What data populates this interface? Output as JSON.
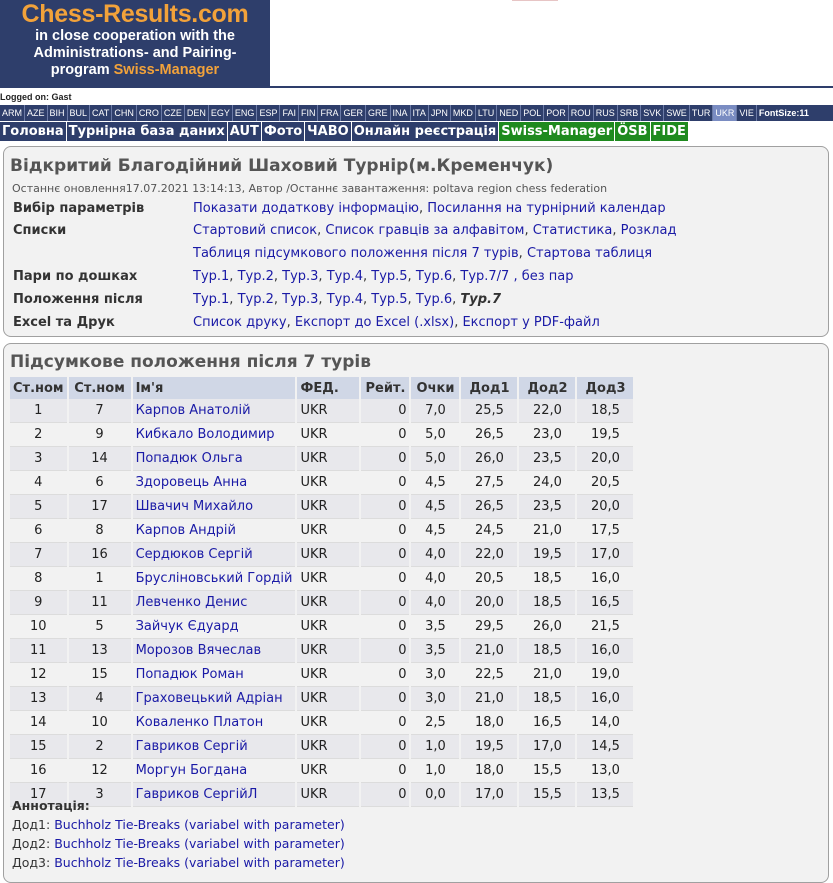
{
  "logo": {
    "title": "Chess-Results.com",
    "line1": "in close cooperation with the",
    "line2": "Administrations- and Pairing-",
    "line3_prefix": "program ",
    "line3_highlight": "Swiss-Manager"
  },
  "logged_on": "Logged on: Gast",
  "languages": [
    "ARM",
    "AZE",
    "BIH",
    "BUL",
    "CAT",
    "CHN",
    "CRO",
    "CZE",
    "DEN",
    "EGY",
    "ENG",
    "ESP",
    "FAI",
    "FIN",
    "FRA",
    "GER",
    "GRE",
    "INA",
    "ITA",
    "JPN",
    "MKD",
    "LTU",
    "NED",
    "POL",
    "POR",
    "ROU",
    "RUS",
    "SRB",
    "SVK",
    "SWE",
    "TUR",
    "UKR",
    "VIE"
  ],
  "active_language": "UKR",
  "font_size": "FontSize:11",
  "nav": [
    {
      "label": "Головна",
      "green": false
    },
    {
      "label": "Турнірна база даних",
      "green": false
    },
    {
      "label": "AUT",
      "green": false
    },
    {
      "label": "Фото",
      "green": false
    },
    {
      "label": "ЧАВО",
      "green": false
    },
    {
      "label": "Онлайн реєстрація",
      "green": false
    },
    {
      "label": "Swiss-Manager",
      "green": true
    },
    {
      "label": "ÖSB",
      "green": true
    },
    {
      "label": "FIDE",
      "green": true
    }
  ],
  "tournament": {
    "name": "Відкритий Благодійний Шаховий Турнір(м.Кременчук)",
    "updated": "Останнє оновлення17.07.2021 13:14:13, Автор /Останнє завантаження: poltava region chess federation"
  },
  "info_rows": [
    {
      "label": "Вибір параметрів",
      "lines": [
        [
          "Показати додаткову інформацію",
          "Посилання на турнірний календар"
        ]
      ]
    },
    {
      "label": "Списки",
      "lines": [
        [
          "Стартовий список",
          "Список гравців за алфавітом",
          "Статистика",
          "Розклад"
        ],
        [
          "Таблиця підсумкового положення після 7 турів",
          "Стартова таблиця"
        ]
      ]
    },
    {
      "label": "Пари по дошках",
      "lines": [
        [
          "Тур.1",
          "Тур.2",
          "Тур.3",
          "Тур.4",
          "Тур.5",
          "Тур.6",
          "Тур.7/7 , без пар"
        ]
      ]
    },
    {
      "label": "Положення після",
      "lines": [
        [
          "Тур.1",
          "Тур.2",
          "Тур.3",
          "Тур.4",
          "Тур.5",
          "Тур.6",
          "Тур.7"
        ]
      ],
      "current": "Тур.7"
    },
    {
      "label": "Excel та Друк",
      "lines": [
        [
          "Список друку",
          "Експорт до Excel (.xlsx)",
          "Експорт у PDF-файл"
        ]
      ]
    }
  ],
  "standings": {
    "title": "Підсумкове положення після 7 турів",
    "headers": [
      "Ст.ном",
      "Ст.ном",
      "Ім'я",
      "ФЕД.",
      "Рейт.",
      "Очки",
      "Дод1",
      "Дод2",
      "Дод3"
    ],
    "rows": [
      [
        "1",
        "7",
        "Карпов Анатолій",
        "UKR",
        "0",
        "7,0",
        "25,5",
        "22,0",
        "18,5"
      ],
      [
        "2",
        "9",
        "Кибкало Володимир",
        "UKR",
        "0",
        "5,0",
        "26,5",
        "23,0",
        "19,5"
      ],
      [
        "3",
        "14",
        "Попадюк Ольга",
        "UKR",
        "0",
        "5,0",
        "26,0",
        "23,5",
        "20,0"
      ],
      [
        "4",
        "6",
        "Здоровець Анна",
        "UKR",
        "0",
        "4,5",
        "27,5",
        "24,0",
        "20,5"
      ],
      [
        "5",
        "17",
        "Швачич Михайло",
        "UKR",
        "0",
        "4,5",
        "26,5",
        "23,5",
        "20,0"
      ],
      [
        "6",
        "8",
        "Карпов Андрій",
        "UKR",
        "0",
        "4,5",
        "24,5",
        "21,0",
        "17,5"
      ],
      [
        "7",
        "16",
        "Сердюков Сергій",
        "UKR",
        "0",
        "4,0",
        "22,0",
        "19,5",
        "17,0"
      ],
      [
        "8",
        "1",
        "Брусліновський Гордій",
        "UKR",
        "0",
        "4,0",
        "20,5",
        "18,5",
        "16,0"
      ],
      [
        "9",
        "11",
        "Левченко Денис",
        "UKR",
        "0",
        "4,0",
        "20,0",
        "18,5",
        "16,5"
      ],
      [
        "10",
        "5",
        "Зайчук Єдуард",
        "UKR",
        "0",
        "3,5",
        "29,5",
        "26,0",
        "21,5"
      ],
      [
        "11",
        "13",
        "Морозов Вячеслав",
        "UKR",
        "0",
        "3,5",
        "21,0",
        "18,5",
        "16,0"
      ],
      [
        "12",
        "15",
        "Попадюк Роман",
        "UKR",
        "0",
        "3,0",
        "22,5",
        "21,0",
        "19,0"
      ],
      [
        "13",
        "4",
        "Граховецький Адріан",
        "UKR",
        "0",
        "3,0",
        "21,0",
        "18,5",
        "16,0"
      ],
      [
        "14",
        "10",
        "Коваленко Платон",
        "UKR",
        "0",
        "2,5",
        "18,0",
        "16,5",
        "14,0"
      ],
      [
        "15",
        "2",
        "Гавриков Сергій",
        "UKR",
        "0",
        "1,0",
        "19,5",
        "17,0",
        "14,5"
      ],
      [
        "16",
        "12",
        "Моргун Богдана",
        "UKR",
        "0",
        "1,0",
        "18,0",
        "15,5",
        "13,0"
      ],
      [
        "17",
        "3",
        "Гавриков СергійЛ",
        "UKR",
        "0",
        "0,0",
        "17,0",
        "15,5",
        "13,5"
      ]
    ]
  },
  "annotation": {
    "title": "Аннотація:",
    "items": [
      {
        "key": "Дод1:",
        "text": "Buchholz Tie-Breaks (variabel with parameter)"
      },
      {
        "key": "Дод2:",
        "text": "Buchholz Tie-Breaks (variabel with parameter)"
      },
      {
        "key": "Дод3:",
        "text": "Buchholz Tie-Breaks (variabel with parameter)"
      }
    ]
  },
  "colors": {
    "brand_navy": "#2e3e6b",
    "brand_orange": "#f2a23a",
    "nav_green": "#1e8a1e",
    "link": "#1a1aa6"
  }
}
